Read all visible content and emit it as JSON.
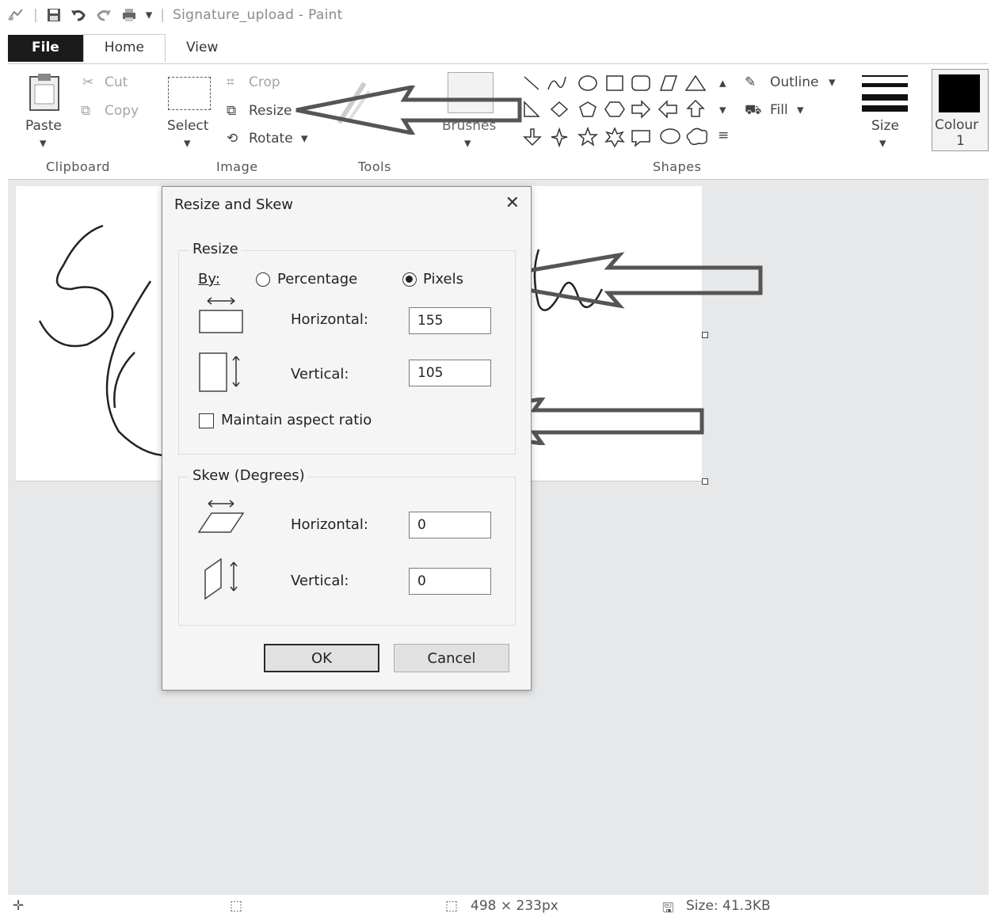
{
  "window": {
    "title": "Signature_upload - Paint"
  },
  "tabs": [
    "File",
    "Home",
    "View"
  ],
  "ribbon": {
    "clipboard": {
      "paste": "Paste",
      "cut": "Cut",
      "copy": "Copy",
      "group": "Clipboard"
    },
    "image": {
      "select": "Select",
      "crop": "Crop",
      "resize": "Resize",
      "rotate": "Rotate",
      "group": "Image"
    },
    "tools": {
      "group": "Tools",
      "brushes": "Brushes"
    },
    "shapes": {
      "outline": "Outline",
      "fill": "Fill",
      "group": "Shapes"
    },
    "size": "Size",
    "colour": {
      "label": "Colour",
      "number": "1",
      "swatch": "#000000"
    }
  },
  "dialog": {
    "title": "Resize and Skew",
    "resize": {
      "legend": "Resize",
      "by_label": "By:",
      "percentage_label": "Percentage",
      "pixels_label": "Pixels",
      "selected": "Pixels",
      "horizontal_label": "Horizontal:",
      "horizontal_value": "155",
      "vertical_label": "Vertical:",
      "vertical_value": "105",
      "maintain_label": "Maintain aspect ratio",
      "maintain_checked": false
    },
    "skew": {
      "legend": "Skew (Degrees)",
      "horizontal_label": "Horizontal:",
      "horizontal_value": "0",
      "vertical_label": "Vertical:",
      "vertical_value": "0"
    },
    "ok_label": "OK",
    "cancel_label": "Cancel"
  },
  "status": {
    "dimensions": "498 × 233px",
    "size": "Size: 41.3KB"
  },
  "colors": {
    "accent": "#1b1b1b",
    "annotation_arrow": "#555555"
  }
}
